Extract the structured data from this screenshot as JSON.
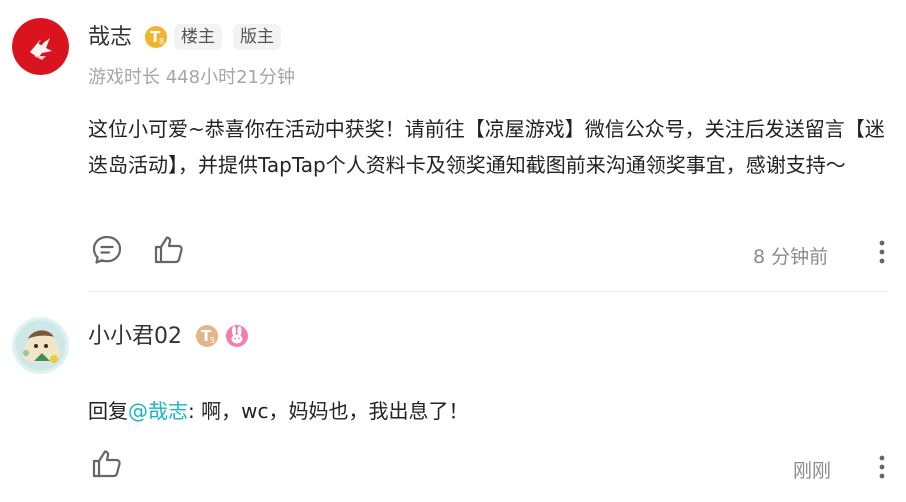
{
  "comments": [
    {
      "username": "哉志",
      "level_badge": "T",
      "level_sub": "8",
      "tags": [
        "楼主",
        "版主"
      ],
      "playtime": "游戏时长 448小时21分钟",
      "text": "这位小可爱~恭喜你在活动中获奖！请前往【凉屋游戏】微信公众号，关注后发送留言【迷迭岛活动】，并提供TapTap个人资料卡及领奖通知截图前来沟通领奖事宜，感谢支持～",
      "time": "8 分钟前",
      "icons": {
        "avatar": "red-bird-avatar",
        "reply": "comment-icon",
        "like": "thumbs-up-icon",
        "more": "more-vertical-icon"
      }
    },
    {
      "username": "小小君02",
      "level_badge": "T",
      "level_sub": "5",
      "text_prefix": "回复",
      "mention": "@哉志",
      "text_rest": ": 啊，wc，妈妈也，我出息了！",
      "time": "刚刚",
      "icons": {
        "avatar": "anime-avatar",
        "extra_badge": "bunny-badge-icon",
        "like": "thumbs-up-icon",
        "more": "more-vertical-icon"
      }
    }
  ],
  "colors": {
    "mention": "#15b6c4",
    "gold_badge": "#f2b42c",
    "bronze_badge": "#e6b48a",
    "pink_badge": "#f07fb0"
  }
}
